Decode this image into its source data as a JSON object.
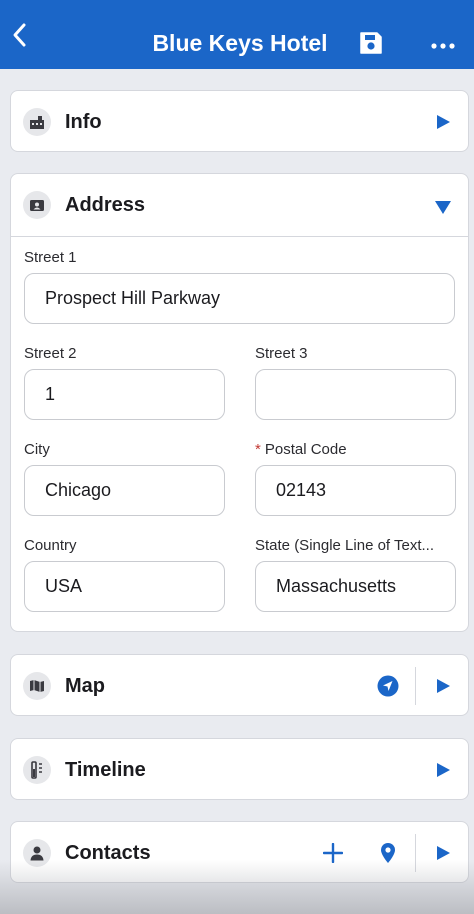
{
  "header": {
    "title": "Blue Keys Hotel",
    "back_icon": "chevron-left-icon",
    "save_icon": "save-icon",
    "more_icon": "more-dots-icon",
    "color": "#1b66c8"
  },
  "sections": {
    "info": {
      "label": "Info",
      "icon": "building-icon",
      "expanded": false
    },
    "address": {
      "label": "Address",
      "icon": "address-card-icon",
      "expanded": true,
      "fields": {
        "street1": {
          "label": "Street 1",
          "value": "Prospect Hill Parkway"
        },
        "street2": {
          "label": "Street 2",
          "value": "1"
        },
        "street3": {
          "label": "Street 3",
          "value": ""
        },
        "city": {
          "label": "City",
          "value": "Chicago"
        },
        "postal": {
          "label": "Postal Code",
          "required_mark": "*",
          "value": "02143"
        },
        "country": {
          "label": "Country",
          "value": "USA"
        },
        "state": {
          "label": "State (Single Line of Text...",
          "value": "Massachusetts"
        }
      }
    },
    "map": {
      "label": "Map",
      "icon": "map-icon",
      "action_icon": "navigate-icon",
      "expanded": false
    },
    "timeline": {
      "label": "Timeline",
      "icon": "timeline-icon",
      "expanded": false
    },
    "contacts": {
      "label": "Contacts",
      "icon": "person-icon",
      "add_icon": "plus-icon",
      "location_icon": "location-pin-icon",
      "expanded": false
    }
  },
  "accent_color": "#1b66c8"
}
